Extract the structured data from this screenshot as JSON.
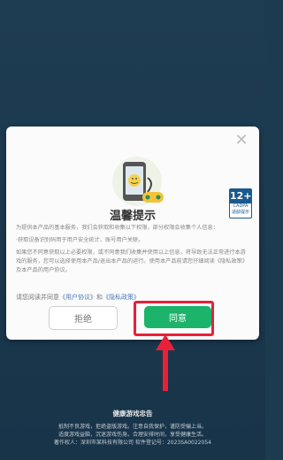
{
  "dialog": {
    "title": "温馨提示",
    "age_rating": {
      "number": "12+",
      "sub": "CADPA",
      "tip": "适龄提示"
    },
    "body_paragraphs": [
      "为提供本产品的基本服务，我们会获取和收集以下权限，部分权限会收集个人信息：",
      "·获取设备识别码用于用户安全统计、账号用户关联。",
      "如果您不同意获取以上必要权限，或不同意我们收集并使用以上信息，将导致无法正常进行本游戏的服务，您可以选择使用本产品/退出本产品的运行。使用本产品前请您仔细阅读《隐私政策》及本产品的用户协议。"
    ],
    "links_prefix": "请您阅读并同意",
    "link_user_agreement": "《用户协议》",
    "link_and": "和",
    "link_privacy": "《隐私政策》",
    "refuse_label": "拒绝",
    "agree_label": "同意"
  },
  "footer": {
    "title": "健康游戏忠告",
    "lines": [
      "抵制不良游戏，拒绝盗版游戏。注意自我保护，谨防受骗上当。",
      "适度游戏益脑，沉迷游戏伤身。合理安排时间，享受健康生活。",
      "著作权人：深圳市某科技有限公司  软件登记号：2023SA0022054"
    ]
  },
  "colors": {
    "agree": "#1cb36b",
    "highlight": "#e8203a",
    "backdrop": "#1d3b4f"
  },
  "icons": [
    "close-icon",
    "phone-illustration",
    "age-rating-badge",
    "red-arrow-icon"
  ]
}
